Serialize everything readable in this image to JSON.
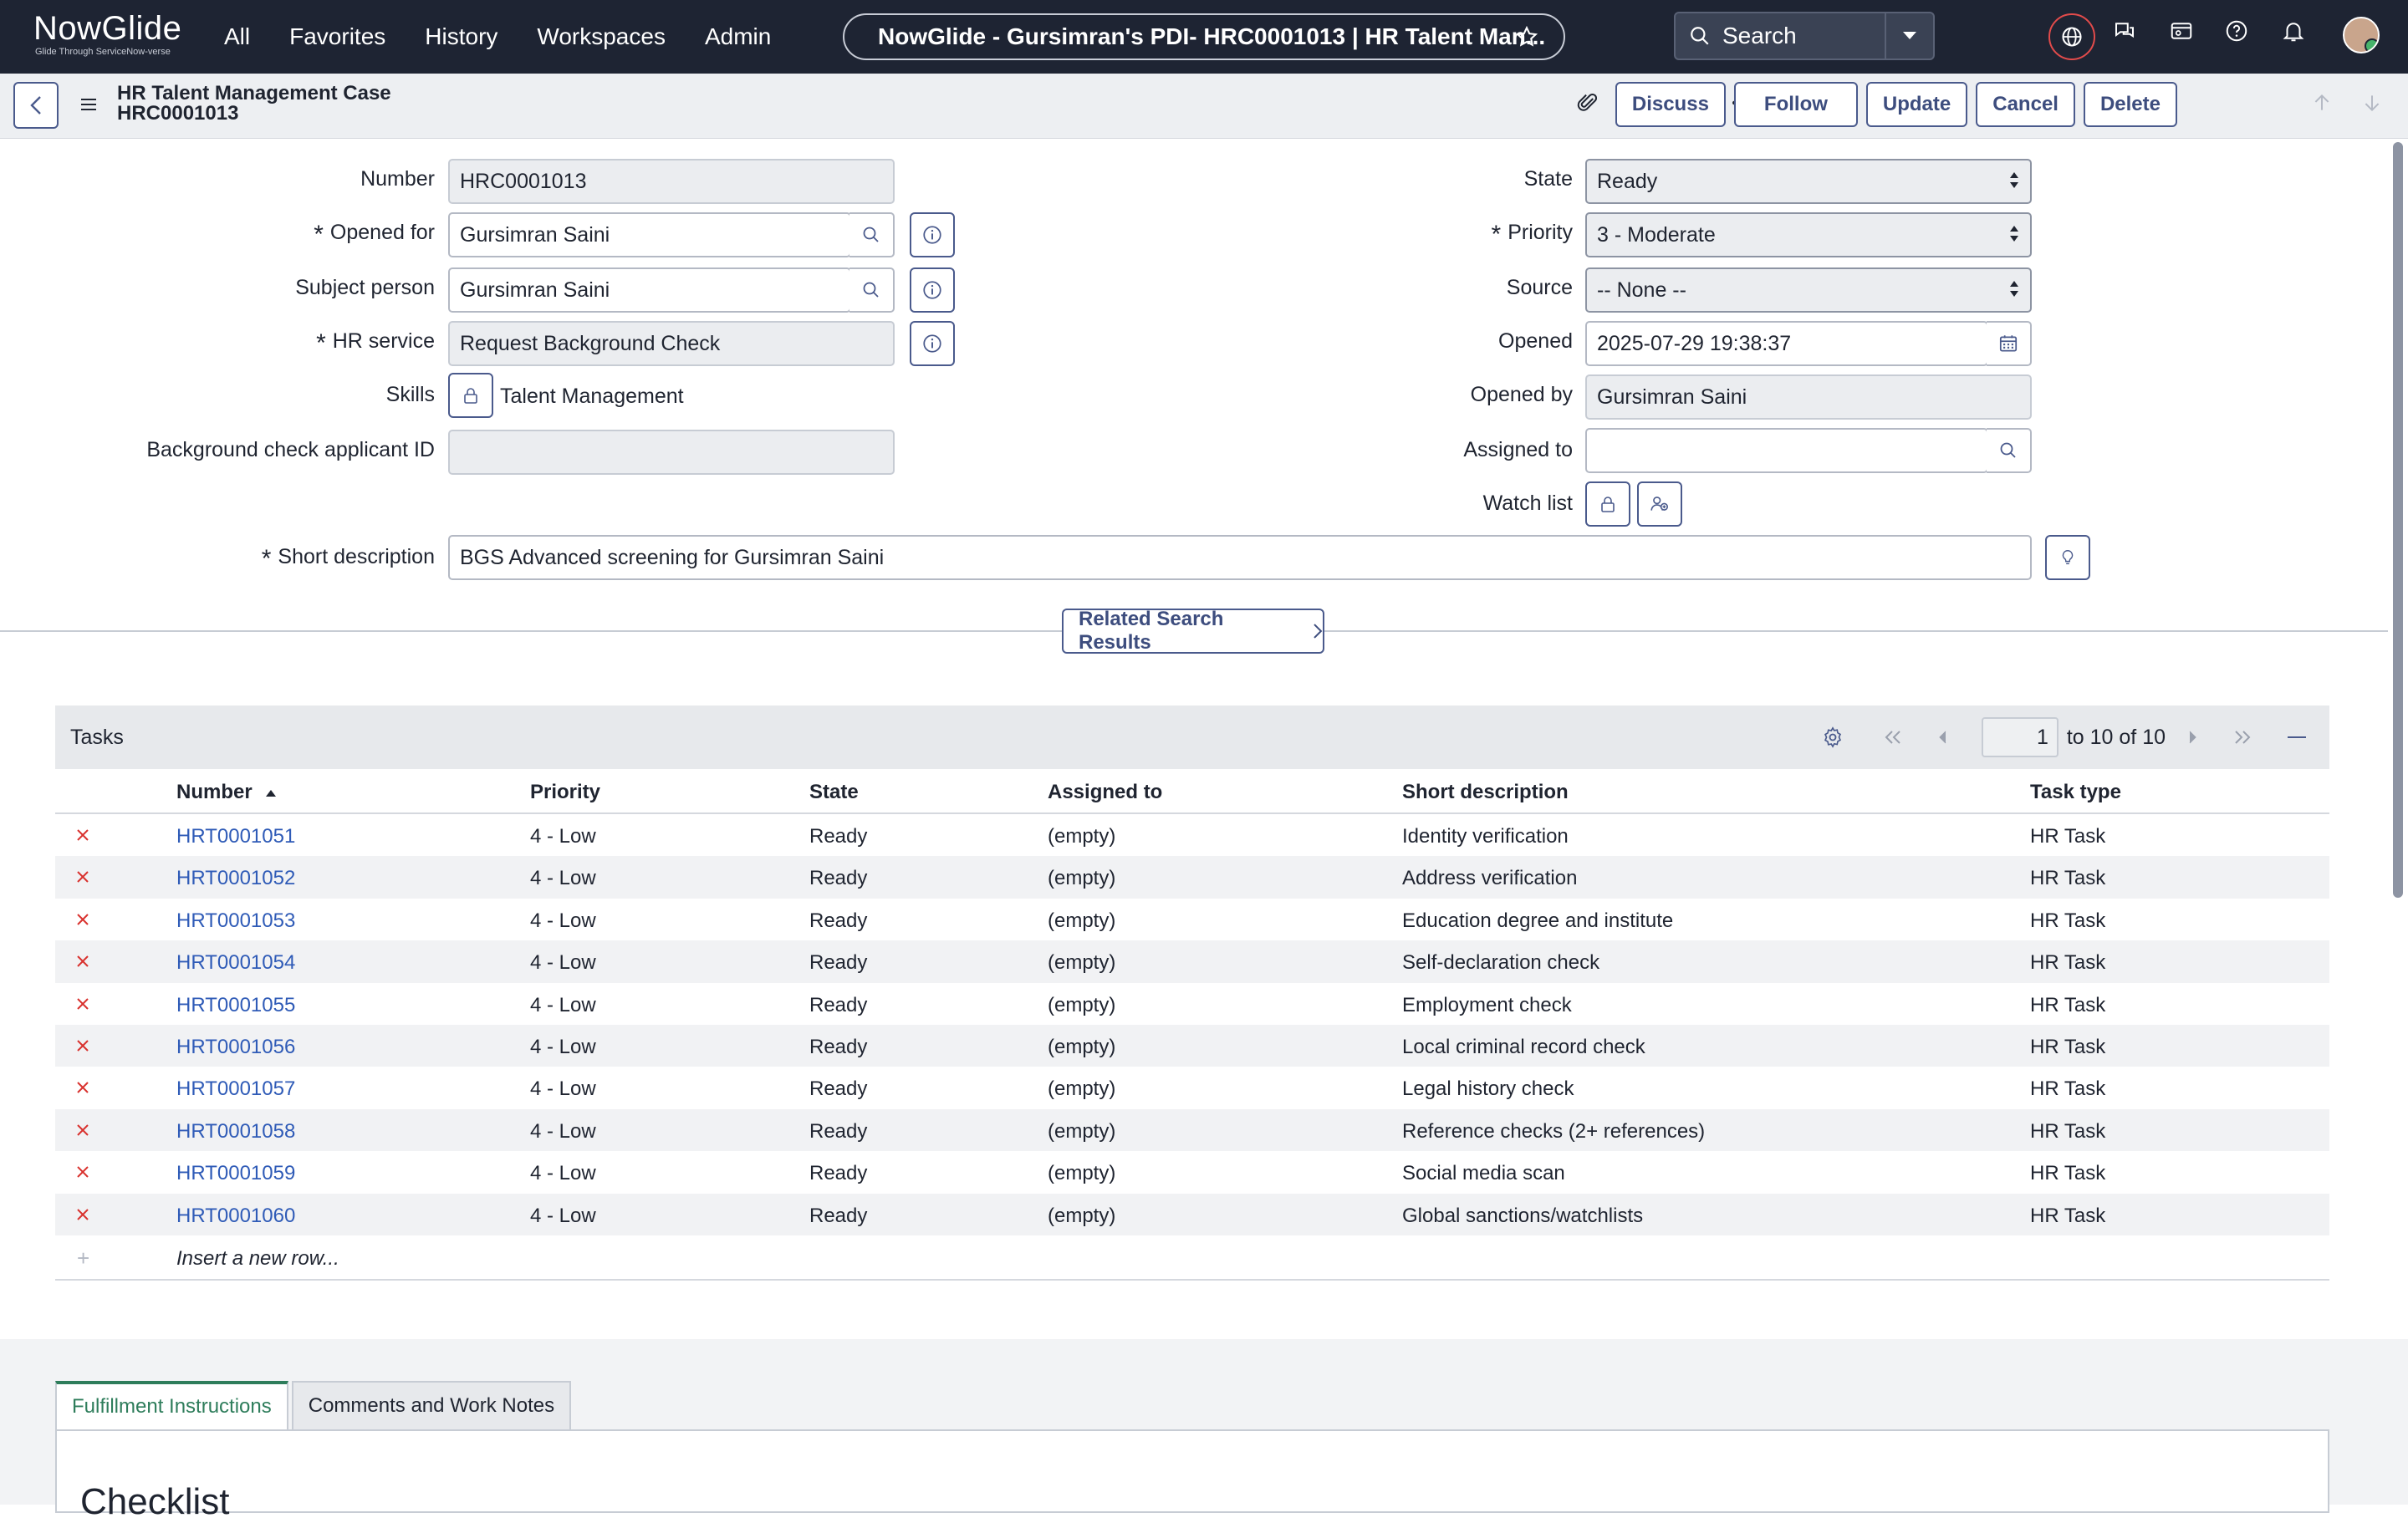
{
  "app": {
    "logo_main": "NowGlide",
    "logo_sub": "Glide Through ServiceNow-verse",
    "nav": [
      "All",
      "Favorites",
      "History",
      "Workspaces",
      "Admin"
    ],
    "window_title": "NowGlide - Gursimran's PDI- HRC0001013 | HR Talent Man...",
    "search_label": "Search"
  },
  "record": {
    "table_label": "HR Talent Management Case",
    "number": "HRC0001013",
    "buttons": {
      "discuss": "Discuss",
      "follow": "Follow",
      "update": "Update",
      "cancel": "Cancel",
      "delete": "Delete"
    }
  },
  "form": {
    "left": {
      "number_label": "Number",
      "number_value": "HRC0001013",
      "opened_for_label": "Opened for",
      "opened_for_value": "Gursimran Saini",
      "subject_person_label": "Subject person",
      "subject_person_value": "Gursimran Saini",
      "hr_service_label": "HR service",
      "hr_service_value": "Request Background Check",
      "skills_label": "Skills",
      "skills_value": "Talent Management",
      "bg_check_label": "Background check applicant ID",
      "bg_check_value": ""
    },
    "right": {
      "state_label": "State",
      "state_value": "Ready",
      "priority_label": "Priority",
      "priority_value": "3 - Moderate",
      "source_label": "Source",
      "source_value": "-- None --",
      "opened_label": "Opened",
      "opened_value": "2025-07-29 19:38:37",
      "opened_by_label": "Opened by",
      "opened_by_value": "Gursimran Saini",
      "assigned_to_label": "Assigned to",
      "assigned_to_value": "",
      "watch_list_label": "Watch list"
    },
    "short_description_label": "Short description",
    "short_description_value": "BGS Advanced screening for Gursimran Saini",
    "related_button": "Related Search Results"
  },
  "tasks": {
    "title": "Tasks",
    "page_value": "1",
    "page_text": "to 10 of 10",
    "columns": [
      "Number",
      "Priority",
      "State",
      "Assigned to",
      "Short description",
      "Task type"
    ],
    "rows": [
      [
        "HRT0001051",
        "4 - Low",
        "Ready",
        "(empty)",
        "Identity verification",
        "HR Task"
      ],
      [
        "HRT0001052",
        "4 - Low",
        "Ready",
        "(empty)",
        "Address verification",
        "HR Task"
      ],
      [
        "HRT0001053",
        "4 - Low",
        "Ready",
        "(empty)",
        "Education degree and institute",
        "HR Task"
      ],
      [
        "HRT0001054",
        "4 - Low",
        "Ready",
        "(empty)",
        "Self-declaration check",
        "HR Task"
      ],
      [
        "HRT0001055",
        "4 - Low",
        "Ready",
        "(empty)",
        "Employment check",
        "HR Task"
      ],
      [
        "HRT0001056",
        "4 - Low",
        "Ready",
        "(empty)",
        "Local criminal record check",
        "HR Task"
      ],
      [
        "HRT0001057",
        "4 - Low",
        "Ready",
        "(empty)",
        "Legal history check",
        "HR Task"
      ],
      [
        "HRT0001058",
        "4 - Low",
        "Ready",
        "(empty)",
        "Reference checks (2+ references)",
        "HR Task"
      ],
      [
        "HRT0001059",
        "4 - Low",
        "Ready",
        "(empty)",
        "Social media scan",
        "HR Task"
      ],
      [
        "HRT0001060",
        "4 - Low",
        "Ready",
        "(empty)",
        "Global sanctions/watchlists",
        "HR Task"
      ]
    ],
    "insert_row": "Insert a new row..."
  },
  "bottom_tabs": {
    "tabs": [
      "Fulfillment Instructions",
      "Comments and Work Notes"
    ],
    "checklist_title": "Checklist"
  },
  "colors": {
    "topbar": "#1e2433",
    "accent": "#4a5a8c",
    "link": "#2f5bb7",
    "active_tab": "#2e7d5b",
    "delete_x": "#d9322e"
  }
}
